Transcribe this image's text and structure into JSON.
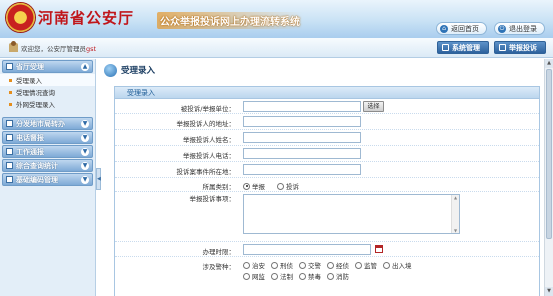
{
  "header": {
    "site_title": "河南省公安厅",
    "system_title": "公众举报投诉网上办理流转系统",
    "home_button": "返回首页",
    "logout_button": "退出登录"
  },
  "infobar": {
    "welcome": "欢迎您，公安厅管理员",
    "username": "gst",
    "sys_manage_button": "系统管理",
    "report_button": "举报投诉"
  },
  "sidebar": {
    "sections": [
      {
        "label": "省厅受理",
        "items": [
          "受理录入",
          "受理情况查询",
          "外网受理录入"
        ]
      },
      {
        "label": "分发地市局转办"
      },
      {
        "label": "电话督报"
      },
      {
        "label": "工作通报"
      },
      {
        "label": "综合查询统计"
      },
      {
        "label": "基础编码管理"
      }
    ]
  },
  "main": {
    "page_title": "受理录入",
    "form_caption": "受理录入",
    "fields": {
      "unit_label": "被投诉/举报单位：",
      "select_button": "选择",
      "address_label": "举报投诉人的地址：",
      "name_label": "举报投诉人姓名：",
      "phone_label": "举报投诉人电话：",
      "location_label": "投诉案事件所在地：",
      "category_label": "所属类别：",
      "category_options": [
        "举报",
        "投诉"
      ],
      "category_selected": "举报",
      "matter_label": "举报投诉事项：",
      "time_label": "办理时限：",
      "police_label": "涉及警种：",
      "police_options_row1": [
        "治安",
        "刑侦",
        "交警",
        "经侦",
        "监管",
        "出入境"
      ],
      "police_options_row2": [
        "网监",
        "法制",
        "禁毒",
        "消防"
      ]
    }
  },
  "colors": {
    "title_red": "#c0161b",
    "nav_blue": "#2d629d",
    "accent_orange": "#e58e1c"
  }
}
